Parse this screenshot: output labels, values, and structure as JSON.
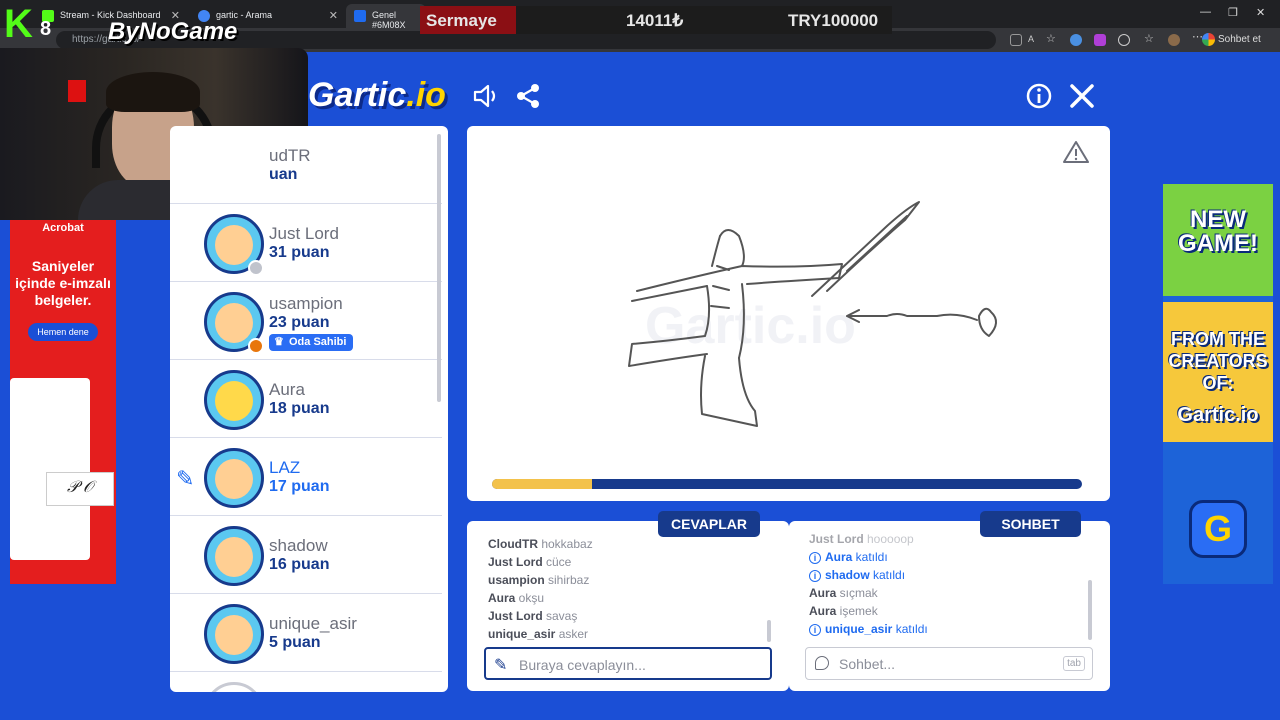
{
  "browser": {
    "tabs": [
      {
        "label": "Stream - Kick Dashboard"
      },
      {
        "label": "gartic - Arama"
      },
      {
        "label": "Genel #6M08X"
      }
    ],
    "url": "https://gartic.io/",
    "profile_button": "Sohbet et"
  },
  "overlay": {
    "ticker_label": "Sermaye",
    "ticker_value_1": "14011₺",
    "ticker_value_2": "TRY100000",
    "kick_count": "8",
    "brand": "ByNoGame"
  },
  "game": {
    "logo_main": "Gartic",
    "logo_suffix": ".io",
    "players": [
      {
        "name": "CloudTR",
        "name_visible": "udTR",
        "points": "puan",
        "points_visible": "uan"
      },
      {
        "name": "Just Lord",
        "points": "31 puan",
        "status_color": "#c0c3cc"
      },
      {
        "name": "usampion",
        "points": "23 puan",
        "badge": "Oda Sahibi",
        "status_color": "#e8760c"
      },
      {
        "name": "Aura",
        "points": "18 puan"
      },
      {
        "name": "LAZ",
        "points": "17 puan",
        "drawing": true
      },
      {
        "name": "shadow",
        "points": "16 puan"
      },
      {
        "name": "unique_asir",
        "points": "5 puan"
      }
    ],
    "canvas": {
      "watermark": "Gartic.io",
      "progress": 0.17
    },
    "answers_panel": {
      "title": "CEVAPLAR",
      "messages": [
        {
          "user": "CloudTR",
          "text": "hokkabaz"
        },
        {
          "user": "Just Lord",
          "text": "cüce"
        },
        {
          "user": "usampion",
          "text": "sihirbaz"
        },
        {
          "user": "Aura",
          "text": "okşu"
        },
        {
          "user": "Just Lord",
          "text": "savaş"
        },
        {
          "user": "unique_asir",
          "text": "asker"
        }
      ],
      "placeholder": "Buraya cevaplayın..."
    },
    "chat_panel": {
      "title": "SOHBET",
      "messages": [
        {
          "user": "Just Lord",
          "text": "hooooop",
          "faded": true
        },
        {
          "user": "Aura",
          "text": "katıldı",
          "system": true
        },
        {
          "user": "shadow",
          "text": "katıldı",
          "system": true
        },
        {
          "user": "Aura",
          "text": "sıçmak"
        },
        {
          "user": "Aura",
          "text": "işemek"
        },
        {
          "user": "unique_asir",
          "text": "katıldı",
          "system": true
        }
      ],
      "placeholder": "Sohbet...",
      "tab_hint": "tab"
    }
  },
  "ads": {
    "left": {
      "brand": "Acrobat",
      "headline": "Saniyeler içinde e-imzalı belgeler.",
      "button": "Hemen dene"
    },
    "right": {
      "line1": "NEW GAME!",
      "line2": "FROM THE CREATORS OF:",
      "line3": "Gartic.io",
      "icon_letter": "G"
    }
  },
  "colors": {
    "page_bg": "#1b4fd6",
    "navy": "#173a8c",
    "accent": "#1f6bf0",
    "progress_fill": "#f3c24b"
  }
}
